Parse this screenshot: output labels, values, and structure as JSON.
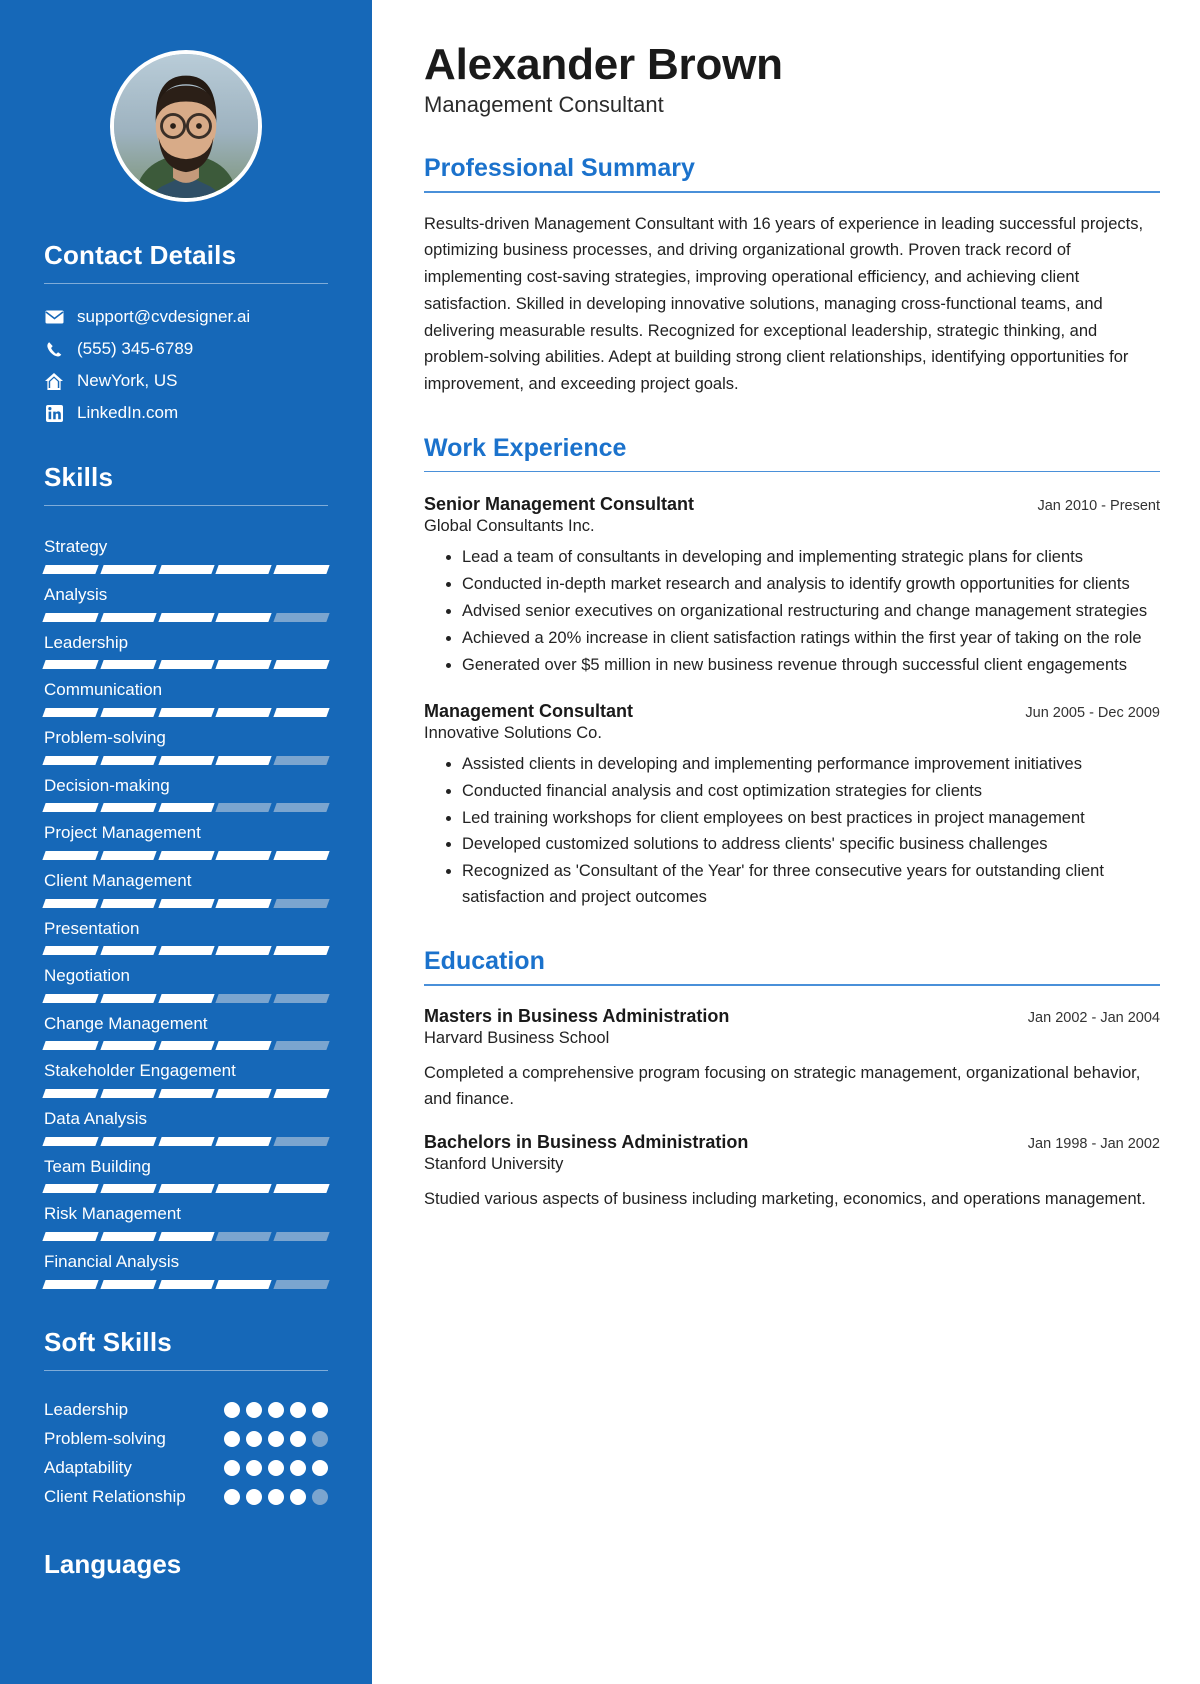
{
  "theme": {
    "sidebar_bg": "#1668b8",
    "accent": "#1b72cc",
    "bar_off": "#7ba5cf"
  },
  "header": {
    "name": "Alexander Brown",
    "role": "Management Consultant"
  },
  "sidebar": {
    "contact": {
      "heading": "Contact Details",
      "items": [
        {
          "icon": "email-icon",
          "value": "support@cvdesigner.ai"
        },
        {
          "icon": "phone-icon",
          "value": "(555) 345-6789"
        },
        {
          "icon": "home-icon",
          "value": "NewYork, US"
        },
        {
          "icon": "linkedin-icon",
          "value": "LinkedIn.com"
        }
      ]
    },
    "skills": {
      "heading": "Skills",
      "max": 5,
      "items": [
        {
          "label": "Strategy",
          "level": 5
        },
        {
          "label": "Analysis",
          "level": 4
        },
        {
          "label": "Leadership",
          "level": 5
        },
        {
          "label": "Communication",
          "level": 5
        },
        {
          "label": "Problem-solving",
          "level": 4
        },
        {
          "label": "Decision-making",
          "level": 3
        },
        {
          "label": "Project Management",
          "level": 5
        },
        {
          "label": "Client Management",
          "level": 4
        },
        {
          "label": "Presentation",
          "level": 5
        },
        {
          "label": "Negotiation",
          "level": 3
        },
        {
          "label": "Change Management",
          "level": 4
        },
        {
          "label": "Stakeholder Engagement",
          "level": 5
        },
        {
          "label": "Data Analysis",
          "level": 4
        },
        {
          "label": "Team Building",
          "level": 5
        },
        {
          "label": "Risk Management",
          "level": 3
        },
        {
          "label": "Financial Analysis",
          "level": 4
        }
      ]
    },
    "soft_skills": {
      "heading": "Soft Skills",
      "max": 5,
      "items": [
        {
          "label": "Leadership",
          "level": 5
        },
        {
          "label": "Problem-solving",
          "level": 4
        },
        {
          "label": "Adaptability",
          "level": 5
        },
        {
          "label": "Client Relationship",
          "level": 4
        }
      ]
    },
    "languages": {
      "heading": "Languages"
    }
  },
  "main": {
    "summary": {
      "title": "Professional Summary",
      "text": "Results-driven Management Consultant with 16 years of experience in leading successful projects, optimizing business processes, and driving organizational growth. Proven track record of implementing cost-saving strategies, improving operational efficiency, and achieving client satisfaction. Skilled in developing innovative solutions, managing cross-functional teams, and delivering measurable results. Recognized for exceptional leadership, strategic thinking, and problem-solving abilities. Adept at building strong client relationships, identifying opportunities for improvement, and exceeding project goals."
    },
    "work": {
      "title": "Work Experience",
      "entries": [
        {
          "title": "Senior Management Consultant",
          "org": "Global Consultants Inc.",
          "date": "Jan 2010 - Present",
          "bullets": [
            "Lead a team of consultants in developing and implementing strategic plans for clients",
            "Conducted in-depth market research and analysis to identify growth opportunities for clients",
            "Advised senior executives on organizational restructuring and change management strategies",
            "Achieved a 20% increase in client satisfaction ratings within the first year of taking on the role",
            "Generated over $5 million in new business revenue through successful client engagements"
          ]
        },
        {
          "title": "Management Consultant",
          "org": "Innovative Solutions Co.",
          "date": "Jun 2005 - Dec 2009",
          "bullets": [
            "Assisted clients in developing and implementing performance improvement initiatives",
            "Conducted financial analysis and cost optimization strategies for clients",
            "Led training workshops for client employees on best practices in project management",
            "Developed customized solutions to address clients' specific business challenges",
            "Recognized as 'Consultant of the Year' for three consecutive years for outstanding client satisfaction and project outcomes"
          ]
        }
      ]
    },
    "education": {
      "title": "Education",
      "entries": [
        {
          "title": "Masters in Business Administration",
          "org": "Harvard Business School",
          "date": "Jan 2002 - Jan 2004",
          "desc": "Completed a comprehensive program focusing on strategic management, organizational behavior, and finance."
        },
        {
          "title": "Bachelors in Business Administration",
          "org": "Stanford University",
          "date": "Jan 1998 - Jan 2002",
          "desc": "Studied various aspects of business including marketing, economics, and operations management."
        }
      ]
    }
  }
}
